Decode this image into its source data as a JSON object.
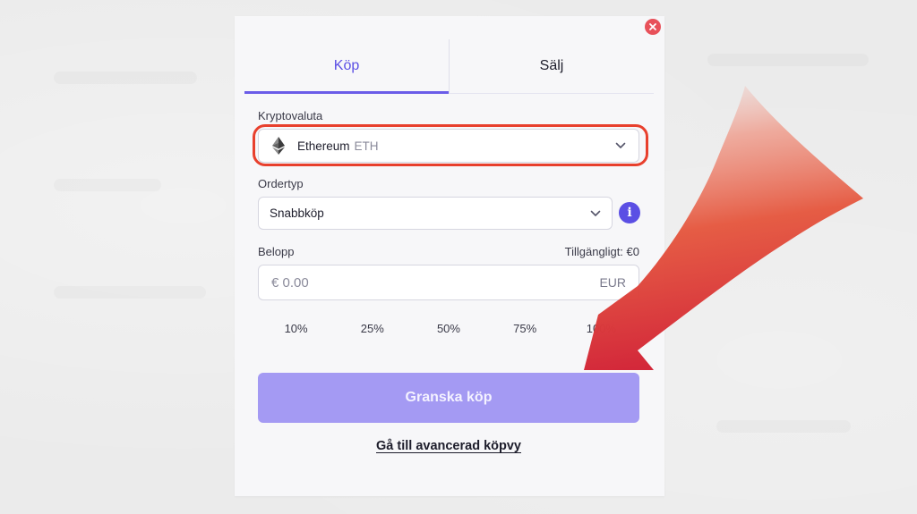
{
  "tabs": {
    "buy": "Köp",
    "sell": "Sälj"
  },
  "crypto": {
    "label": "Kryptovaluta",
    "name": "Ethereum",
    "ticker": "ETH"
  },
  "order": {
    "label": "Ordertyp",
    "value": "Snabbköp"
  },
  "amount": {
    "label": "Belopp",
    "available": "Tillgängligt: €0",
    "placeholder": "€ 0.00",
    "currency": "EUR"
  },
  "percentages": [
    "10%",
    "25%",
    "50%",
    "75%",
    "100%"
  ],
  "review_button": "Granska köp",
  "advanced_link": "Gå till avancerad köpvy",
  "colors": {
    "accent": "#5b4fe4",
    "button": "#a49af3",
    "highlight": "#e8402d",
    "close": "#e8515a"
  },
  "icons": {
    "close": "close-icon",
    "crypto": "ethereum-icon",
    "dropdown": "chevron-down-icon",
    "info": "info-icon"
  }
}
